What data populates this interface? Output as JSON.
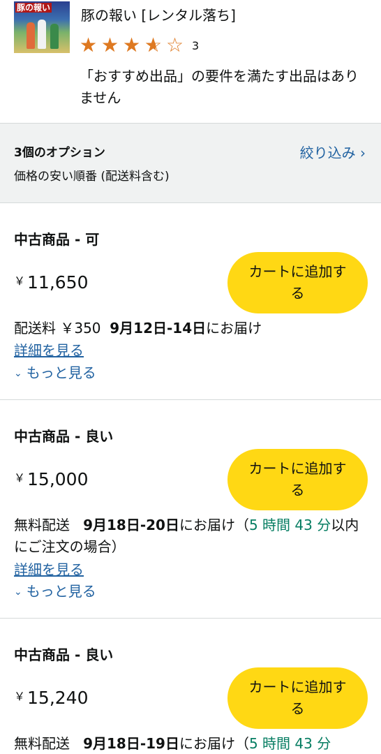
{
  "product": {
    "title": "豚の報い [レンタル落ち]",
    "thumbnail_label": "豚の報い",
    "rating": 3.5,
    "rating_count": "3",
    "notice": "「おすすめ出品」の要件を満たす出品はありません"
  },
  "options": {
    "count_label": "3個のオプション",
    "sort_label": "価格の安い順番 (配送料含む)",
    "filter_label": "絞り込み ›"
  },
  "offers": [
    {
      "condition": "中古商品 - 可",
      "currency": "￥",
      "price": "11,650",
      "add_to_cart": "カートに追加する",
      "shipping": "配送料 ￥350",
      "delivery_date": "9月12日-14日",
      "delivery_suffix": "にお届け",
      "countdown": "",
      "countdown_suffix": "",
      "details": "詳細を見る",
      "more": "もっと見る"
    },
    {
      "condition": "中古商品 - 良い",
      "currency": "￥",
      "price": "15,000",
      "add_to_cart": "カートに追加する",
      "shipping": "無料配送",
      "delivery_date": "9月18日-20日",
      "delivery_suffix": "にお届け（",
      "countdown": "5 時間 43 分",
      "countdown_suffix": "以内にご注文の場合）",
      "details": "詳細を見る",
      "more": "もっと見る"
    },
    {
      "condition": "中古商品 - 良い",
      "currency": "￥",
      "price": "15,240",
      "add_to_cart": "カートに追加する",
      "shipping": "無料配送",
      "delivery_date": "9月18日-19日",
      "delivery_suffix": "にお届け（",
      "countdown": "5 時間 43 分",
      "countdown_suffix": "",
      "details": "",
      "more": ""
    }
  ],
  "colors": {
    "star": "#de7921",
    "link": "#2162a1",
    "cart_button": "#ffd814",
    "countdown": "#067d62"
  }
}
